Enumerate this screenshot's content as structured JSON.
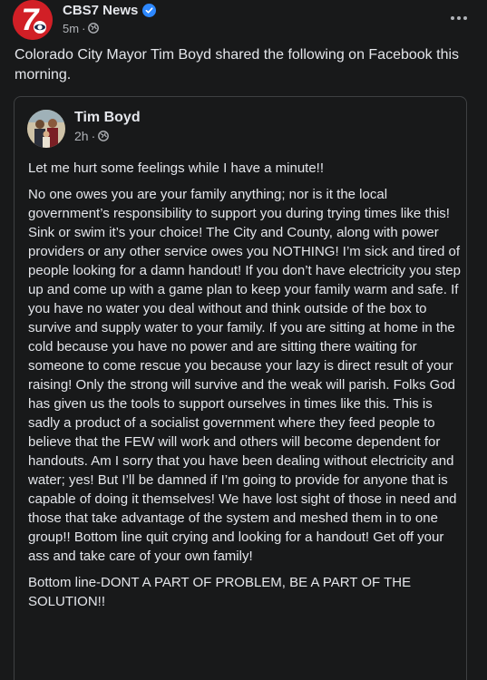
{
  "post": {
    "page_name": "CBS7 News",
    "page_logo_text": "7",
    "time": "5m",
    "caption": "Colorado City Mayor Tim Boyd shared the following on Facebook this morning."
  },
  "shared_post": {
    "author": "Tim Boyd",
    "time": "2h",
    "paragraphs": [
      "Let me hurt some feelings while I have a minute!!",
      "No one owes you are your family anything; nor is it the local government’s responsibility to support you during trying times like this! Sink or swim it’s your choice!  The City and County, along with power providers or any other service owes you NOTHING!  I’m sick and tired of people looking for a damn handout!  If you don’t have electricity you step up and come up with a game plan to keep your family warm and safe. If you have no water you deal without and think outside of the box to survive and supply water to your family. If you are sitting at home in the cold because you have no power and are sitting there waiting for someone to come rescue you because your lazy is direct result of your raising!  Only the strong will survive and the weak will parish. Folks God has given us the tools to support ourselves in times like this. This is sadly a product of a socialist government where they feed people to believe that the FEW will work and others will become dependent for handouts. Am I sorry that you have been dealing without electricity and water; yes! But I’ll be damned if I’m going to provide for anyone that is capable of doing it themselves!  We have lost sight of those in need and those that take advantage of the system and meshed them in to one group!! Bottom line quit crying and looking for a handout! Get off your ass and take care of your own family!",
      "Bottom line-DONT A PART OF PROBLEM, BE A PART OF THE SOLUTION!!"
    ]
  },
  "icons": {
    "verified": "verified-badge-icon",
    "audience": "globe-icon",
    "more": "more-options-icon"
  },
  "colors": {
    "background": "#18191a",
    "text_primary": "#e4e6eb",
    "text_secondary": "#b0b3b8",
    "brand_red": "#d11f26",
    "verified_blue": "#2d88ff",
    "card_border": "#3e4042"
  }
}
